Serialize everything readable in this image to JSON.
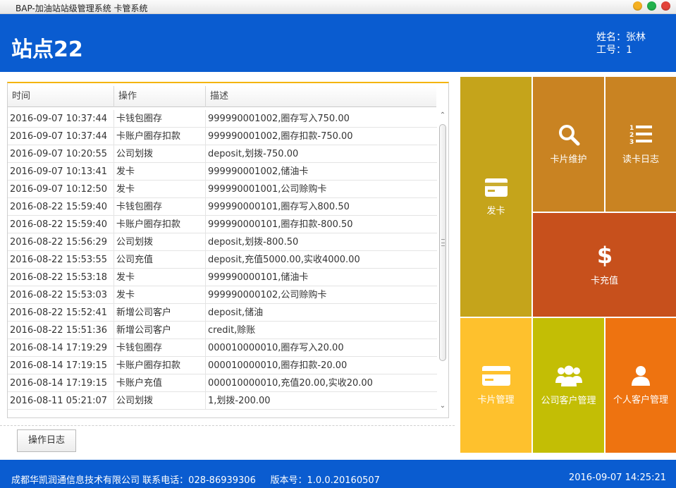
{
  "window": {
    "title": "BAP-加油站站级管理系统 卡管系统",
    "controls": {
      "minimize": "#f5b021",
      "maximize": "#22b14c",
      "close": "#e3433a"
    }
  },
  "colors": {
    "header_blue": "#0a5cd0",
    "accent_orange": "#f4b400"
  },
  "header": {
    "station": "站点22",
    "name_label": "姓名：",
    "name": "张林",
    "id_label": "工号：",
    "id": "1"
  },
  "log": {
    "columns": [
      "时间",
      "操作",
      "描述"
    ],
    "rows": [
      {
        "time": "2016-09-07 10:37:44",
        "op": "卡钱包圈存",
        "desc": "999990001002,圈存写入750.00"
      },
      {
        "time": "2016-09-07 10:37:44",
        "op": "卡账户圈存扣款",
        "desc": "999990001002,圈存扣款-750.00"
      },
      {
        "time": "2016-09-07 10:20:55",
        "op": "公司划拨",
        "desc": "deposit,划拨-750.00"
      },
      {
        "time": "2016-09-07 10:13:41",
        "op": "发卡",
        "desc": "999990001002,储油卡"
      },
      {
        "time": "2016-09-07 10:12:50",
        "op": "发卡",
        "desc": "999990001001,公司赊购卡"
      },
      {
        "time": "2016-08-22 15:59:40",
        "op": "卡钱包圈存",
        "desc": "999990000101,圈存写入800.50"
      },
      {
        "time": "2016-08-22 15:59:40",
        "op": "卡账户圈存扣款",
        "desc": "999990000101,圈存扣款-800.50"
      },
      {
        "time": "2016-08-22 15:56:29",
        "op": "公司划拨",
        "desc": "deposit,划拨-800.50"
      },
      {
        "time": "2016-08-22 15:53:55",
        "op": "公司充值",
        "desc": "deposit,充值5000.00,实收4000.00"
      },
      {
        "time": "2016-08-22 15:53:18",
        "op": "发卡",
        "desc": "999990000101,储油卡"
      },
      {
        "time": "2016-08-22 15:53:03",
        "op": "发卡",
        "desc": "999990000102,公司赊购卡"
      },
      {
        "time": "2016-08-22 15:52:41",
        "op": "新增公司客户",
        "desc": "deposit,储油"
      },
      {
        "time": "2016-08-22 15:51:36",
        "op": "新增公司客户",
        "desc": "credit,赊账"
      },
      {
        "time": "2016-08-14 17:19:29",
        "op": "卡钱包圈存",
        "desc": "000010000010,圈存写入20.00"
      },
      {
        "time": "2016-08-14 17:19:15",
        "op": "卡账户圈存扣款",
        "desc": "000010000010,圈存扣款-20.00"
      },
      {
        "time": "2016-08-14 17:19:15",
        "op": "卡账户充值",
        "desc": "000010000010,充值20.00,实收20.00"
      },
      {
        "time": "2016-08-11 05:21:07",
        "op": "公司划拨",
        "desc": "1,划拨-200.00"
      }
    ],
    "tab_label": "操作日志"
  },
  "tiles": [
    {
      "key": "issue",
      "label": "发卡",
      "icon": "card-icon",
      "color": "#c5a41b"
    },
    {
      "key": "maintain",
      "label": "卡片维护",
      "icon": "search-icon",
      "color": "#c98322"
    },
    {
      "key": "readlog",
      "label": "读卡日志",
      "icon": "numbered-list-icon",
      "color": "#c98322"
    },
    {
      "key": "recharge",
      "label": "卡充值",
      "icon": "dollar-icon",
      "color": "#c7501c"
    },
    {
      "key": "cardmgmt",
      "label": "卡片管理",
      "icon": "card-icon",
      "color": "#fec12d"
    },
    {
      "key": "corp",
      "label": "公司客户管理",
      "icon": "group-icon",
      "color": "#c3be05"
    },
    {
      "key": "personal",
      "label": "个人客户管理",
      "icon": "person-icon",
      "color": "#ee7310"
    }
  ],
  "footer": {
    "company": "成都华凯润通信息技术有限公司",
    "phone_label": "联系电话：",
    "phone": "028-86939306",
    "version_label": "版本号：",
    "version": "1.0.0.20160507",
    "datetime": "2016-09-07 14:25:21"
  }
}
